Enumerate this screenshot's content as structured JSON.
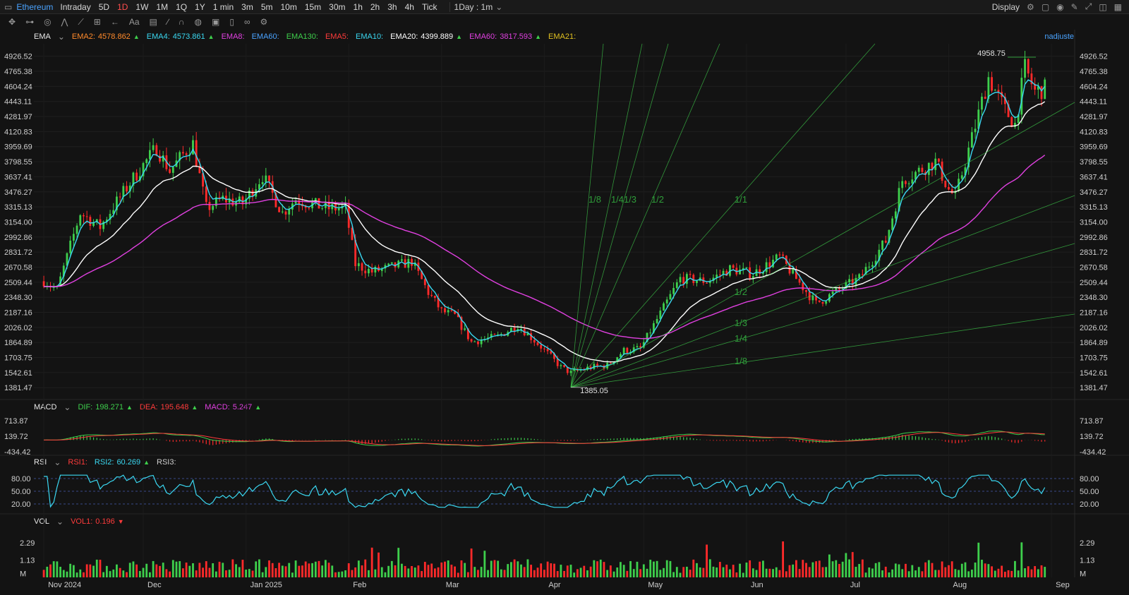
{
  "topbar": {
    "symbol": "Ethereum",
    "timeframes": [
      "Intraday",
      "5D",
      "1D",
      "1W",
      "1M",
      "1Q",
      "1Y",
      "1 min",
      "3m",
      "5m",
      "10m",
      "15m",
      "30m",
      "1h",
      "2h",
      "3h",
      "4h",
      "Tick"
    ],
    "active_timeframe": "1D",
    "period_select": "1Day : 1m",
    "display_label": "Display"
  },
  "overlay": {
    "user_label": "nadjuste"
  },
  "indicators": {
    "ema": {
      "name": "EMA",
      "items": [
        {
          "label": "EMA2:",
          "value": "4578.862",
          "color": "#ff8a2b",
          "dir": "up"
        },
        {
          "label": "EMA4:",
          "value": "4573.861",
          "color": "#3ad7f0",
          "dir": "up"
        },
        {
          "label": "EMA8:",
          "value": "",
          "color": "#e040e0",
          "dir": ""
        },
        {
          "label": "EMA60:",
          "value": "",
          "color": "#4aa3ff",
          "dir": ""
        },
        {
          "label": "EMA130:",
          "value": "",
          "color": "#3ecf4c",
          "dir": ""
        },
        {
          "label": "EMA5:",
          "value": "",
          "color": "#ff3b3b",
          "dir": ""
        },
        {
          "label": "EMA10:",
          "value": "",
          "color": "#3ad7f0",
          "dir": ""
        },
        {
          "label": "EMA20:",
          "value": "4399.889",
          "color": "#ffffff",
          "dir": "up"
        },
        {
          "label": "EMA60:",
          "value": "3817.593",
          "color": "#e040e0",
          "dir": "up"
        },
        {
          "label": "EMA21:",
          "value": "",
          "color": "#e0c020",
          "dir": ""
        }
      ]
    },
    "macd": {
      "name": "MACD",
      "items": [
        {
          "label": "DIF:",
          "value": "198.271",
          "color": "#3ecf4c",
          "dir": "up"
        },
        {
          "label": "DEA:",
          "value": "195.648",
          "color": "#ff3b3b",
          "dir": "up"
        },
        {
          "label": "MACD:",
          "value": "5.247",
          "color": "#e040e0",
          "dir": "up"
        }
      ]
    },
    "rsi": {
      "name": "RSI",
      "items": [
        {
          "label": "RSI1:",
          "value": "",
          "color": "#ff3b3b",
          "dir": ""
        },
        {
          "label": "RSI2:",
          "value": "60.269",
          "color": "#3ad7f0",
          "dir": "up"
        },
        {
          "label": "RSI3:",
          "value": "",
          "color": "#cfcfcf",
          "dir": ""
        }
      ]
    },
    "vol": {
      "name": "VOL",
      "items": [
        {
          "label": "VOL1:",
          "value": "0.196",
          "color": "#ff3b3b",
          "dir": "down"
        }
      ]
    }
  },
  "chart_data": [
    {
      "type": "candlestick",
      "title": "",
      "x_ticks": [
        "Nov 2024",
        "Dec",
        "Jan 2025",
        "Feb",
        "Mar",
        "Apr",
        "May",
        "Jun",
        "Jul",
        "Aug",
        "Sep"
      ],
      "y_ticks": [
        "4926.52",
        "4765.38",
        "4604.24",
        "4443.11",
        "4281.97",
        "4120.83",
        "3959.69",
        "3798.55",
        "3637.41",
        "3476.27",
        "3315.13",
        "3154.00",
        "2992.86",
        "2831.72",
        "2670.58",
        "2509.44",
        "2348.30",
        "2187.16",
        "2026.02",
        "1864.89",
        "1703.75",
        "1542.61",
        "1381.47"
      ],
      "ylim": [
        1300,
        5060
      ],
      "annotations": {
        "high": "4958.75",
        "low": "1385.05"
      },
      "close_anchors": [
        [
          "2024-11-01",
          2520
        ],
        [
          "2024-11-05",
          2430
        ],
        [
          "2024-11-12",
          3250
        ],
        [
          "2024-11-18",
          3100
        ],
        [
          "2024-11-22",
          3320
        ],
        [
          "2024-11-28",
          3620
        ],
        [
          "2024-12-05",
          3950
        ],
        [
          "2024-12-09",
          3700
        ],
        [
          "2024-12-14",
          3920
        ],
        [
          "2024-12-16",
          3990
        ],
        [
          "2024-12-20",
          3300
        ],
        [
          "2024-12-25",
          3400
        ],
        [
          "2024-12-31",
          3350
        ],
        [
          "2025-01-06",
          3650
        ],
        [
          "2025-01-12",
          3250
        ],
        [
          "2025-01-16",
          3400
        ],
        [
          "2025-01-20",
          3350
        ],
        [
          "2025-01-26",
          3300
        ],
        [
          "2025-01-31",
          3300
        ],
        [
          "2025-02-03",
          2700
        ],
        [
          "2025-02-08",
          2620
        ],
        [
          "2025-02-15",
          2680
        ],
        [
          "2025-02-20",
          2730
        ],
        [
          "2025-02-25",
          2400
        ],
        [
          "2025-03-01",
          2200
        ],
        [
          "2025-03-05",
          2150
        ],
        [
          "2025-03-10",
          1870
        ],
        [
          "2025-03-18",
          1930
        ],
        [
          "2025-03-24",
          2050
        ],
        [
          "2025-03-31",
          1820
        ],
        [
          "2025-04-06",
          1600
        ],
        [
          "2025-04-09",
          1540
        ],
        [
          "2025-04-15",
          1600
        ],
        [
          "2025-04-20",
          1620
        ],
        [
          "2025-04-25",
          1780
        ],
        [
          "2025-04-30",
          1800
        ],
        [
          "2025-05-08",
          2300
        ],
        [
          "2025-05-12",
          2550
        ],
        [
          "2025-05-20",
          2520
        ],
        [
          "2025-05-27",
          2650
        ],
        [
          "2025-06-03",
          2600
        ],
        [
          "2025-06-11",
          2780
        ],
        [
          "2025-06-17",
          2500
        ],
        [
          "2025-06-22",
          2280
        ],
        [
          "2025-06-30",
          2450
        ],
        [
          "2025-07-05",
          2550
        ],
        [
          "2025-07-10",
          2800
        ],
        [
          "2025-07-13",
          2950
        ],
        [
          "2025-07-18",
          3600
        ],
        [
          "2025-07-23",
          3700
        ],
        [
          "2025-07-28",
          3800
        ],
        [
          "2025-08-01",
          3500
        ],
        [
          "2025-08-03",
          3420
        ],
        [
          "2025-08-08",
          4050
        ],
        [
          "2025-08-13",
          4700
        ],
        [
          "2025-08-18",
          4350
        ],
        [
          "2025-08-21",
          4200
        ],
        [
          "2025-08-24",
          4800
        ],
        [
          "2025-08-27",
          4550
        ],
        [
          "2025-08-30",
          4578
        ]
      ],
      "series": [
        {
          "name": "EMA2",
          "color": "#3ad7f0",
          "period": 4
        },
        {
          "name": "EMA20",
          "color": "#ffffff",
          "period": 20
        },
        {
          "name": "EMA60",
          "color": "#e040e0",
          "period": 60
        }
      ],
      "gann_fan": {
        "origin": [
          "2025-04-09",
          1385.05
        ],
        "labels": [
          "1/8",
          "1/4",
          "1/3",
          "1/2",
          "1/1",
          "1/2",
          "1/3",
          "1/4",
          "1/8"
        ],
        "color": "#3ecf4c"
      }
    },
    {
      "type": "macd",
      "y_ticks": [
        "713.87",
        "139.72",
        "-434.42"
      ],
      "ylim": [
        -434.42,
        713.87
      ],
      "series": [
        {
          "name": "DIF",
          "color": "#3ecf4c"
        },
        {
          "name": "DEA",
          "color": "#ff3b3b"
        },
        {
          "name": "MACD",
          "color": "#e040e0"
        }
      ]
    },
    {
      "type": "rsi",
      "y_ticks": [
        "80.00",
        "50.00",
        "20.00"
      ],
      "ylim": [
        10,
        90
      ],
      "series": [
        {
          "name": "RSI2",
          "color": "#3ad7f0"
        }
      ]
    },
    {
      "type": "bar",
      "y_ticks": [
        "2.29",
        "1.13",
        "M"
      ],
      "ylim": [
        0,
        2.7
      ],
      "series": [
        {
          "name": "VOL1",
          "color": "#3ecf4c"
        }
      ]
    }
  ]
}
